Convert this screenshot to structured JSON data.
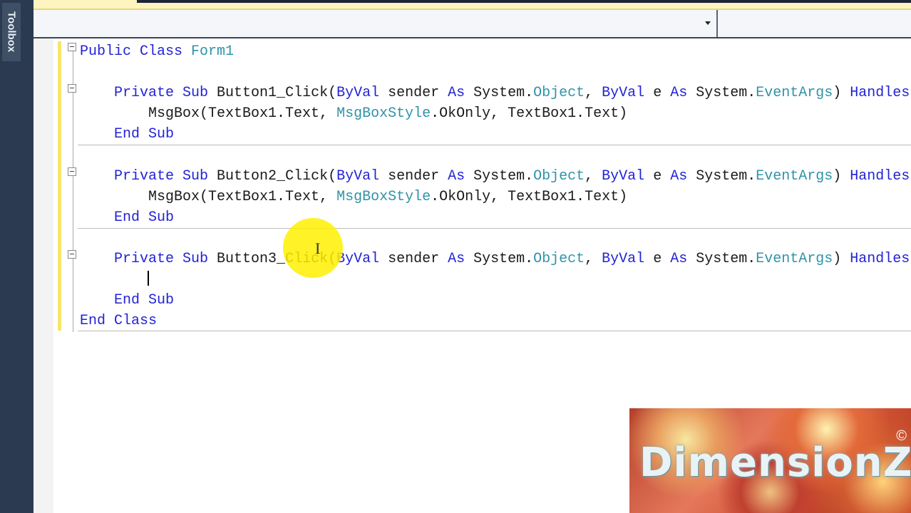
{
  "toolbox": {
    "label": "Toolbox"
  },
  "navbar": {
    "left_value": "",
    "right_value": ""
  },
  "code_lines": [
    [
      [
        "Public ",
        "kw"
      ],
      [
        "Class ",
        "kw"
      ],
      [
        "Form1",
        "ty"
      ]
    ],
    [],
    [
      [
        "    Private ",
        "kw"
      ],
      [
        "Sub ",
        "kw"
      ],
      [
        "Button1_Click(",
        ""
      ],
      [
        "ByVal ",
        "kw"
      ],
      [
        "sender ",
        ""
      ],
      [
        "As ",
        "kw"
      ],
      [
        "System.",
        ""
      ],
      [
        "Object",
        "ty"
      ],
      [
        ", ",
        ""
      ],
      [
        "ByVal ",
        "kw"
      ],
      [
        "e ",
        ""
      ],
      [
        "As ",
        "kw"
      ],
      [
        "System.",
        ""
      ],
      [
        "EventArgs",
        "ty"
      ],
      [
        ") ",
        ""
      ],
      [
        "Handles",
        "kw"
      ]
    ],
    [
      [
        "        MsgBox(TextBox1.Text, ",
        ""
      ],
      [
        "MsgBoxStyle",
        "ty"
      ],
      [
        ".OkOnly, TextBox1.Text)",
        ""
      ]
    ],
    [
      [
        "    End ",
        "kw"
      ],
      [
        "Sub",
        "kw"
      ]
    ],
    [],
    [
      [
        "    Private ",
        "kw"
      ],
      [
        "Sub ",
        "kw"
      ],
      [
        "Button2_Click(",
        ""
      ],
      [
        "ByVal ",
        "kw"
      ],
      [
        "sender ",
        ""
      ],
      [
        "As ",
        "kw"
      ],
      [
        "System.",
        ""
      ],
      [
        "Object",
        "ty"
      ],
      [
        ", ",
        ""
      ],
      [
        "ByVal ",
        "kw"
      ],
      [
        "e ",
        ""
      ],
      [
        "As ",
        "kw"
      ],
      [
        "System.",
        ""
      ],
      [
        "EventArgs",
        "ty"
      ],
      [
        ") ",
        ""
      ],
      [
        "Handles",
        "kw"
      ]
    ],
    [
      [
        "        MsgBox(TextBox1.Text, ",
        ""
      ],
      [
        "MsgBoxStyle",
        "ty"
      ],
      [
        ".OkOnly, TextBox1.Text)",
        ""
      ]
    ],
    [
      [
        "    End ",
        "kw"
      ],
      [
        "Sub",
        "kw"
      ]
    ],
    [],
    [
      [
        "    Private ",
        "kw"
      ],
      [
        "Sub ",
        "kw"
      ],
      [
        "Button3_Click(",
        ""
      ],
      [
        "ByVal ",
        "kw"
      ],
      [
        "sender ",
        ""
      ],
      [
        "As ",
        "kw"
      ],
      [
        "System.",
        ""
      ],
      [
        "Object",
        "ty"
      ],
      [
        ", ",
        ""
      ],
      [
        "ByVal ",
        "kw"
      ],
      [
        "e ",
        ""
      ],
      [
        "As ",
        "kw"
      ],
      [
        "System.",
        ""
      ],
      [
        "EventArgs",
        "ty"
      ],
      [
        ") ",
        ""
      ],
      [
        "Handles",
        "kw"
      ]
    ],
    [
      [
        "        ",
        ""
      ]
    ],
    [
      [
        "    End ",
        "kw"
      ],
      [
        "Sub",
        "kw"
      ]
    ],
    [
      [
        "End ",
        "kw"
      ],
      [
        "Class",
        "kw"
      ]
    ]
  ],
  "colors": {
    "keyword": "#2323d6",
    "type": "#2f93a8",
    "change_bar": "#f6e56a"
  },
  "watermark": {
    "text": "DimensionZ",
    "symbol": "©"
  }
}
